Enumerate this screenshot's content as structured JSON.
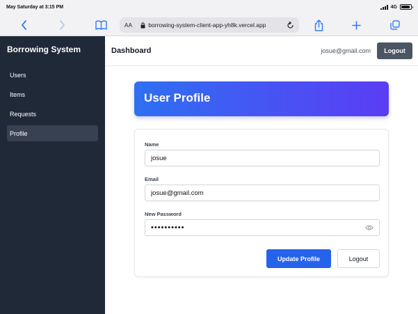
{
  "status_bar": {
    "time": "May Saturday at 3:15 PM",
    "network": "4G",
    "battery_level": 0.9
  },
  "browser": {
    "text_size_label": "AA",
    "url": "borrowing-system-client-app-yh8k.vercel.app",
    "icons": [
      "back-icon",
      "forward-icon",
      "bookmarks-icon",
      "lock-icon",
      "reload-icon",
      "share-icon",
      "new-tab-icon",
      "tabs-icon"
    ]
  },
  "sidebar": {
    "brand": "Borrowing System",
    "items": [
      {
        "label": "Users",
        "active": false
      },
      {
        "label": "Items",
        "active": false
      },
      {
        "label": "Requests",
        "active": false
      },
      {
        "label": "Profile",
        "active": true
      }
    ]
  },
  "header": {
    "title": "Dashboard",
    "user_email": "josue@gmail.com",
    "logout_label": "Logout"
  },
  "profile": {
    "title": "User Profile",
    "name_label": "Name",
    "name_value": "josue",
    "email_label": "Email",
    "email_value": "josue@gmail.com",
    "password_label": "New Password",
    "password_value": "••••••••••",
    "update_label": "Update Profile",
    "logout_label": "Logout"
  },
  "colors": {
    "sidebar_bg": "#1f2937",
    "accent": "#2563eb",
    "gradient_start": "#2f6ff2",
    "gradient_end": "#5b3df4"
  }
}
